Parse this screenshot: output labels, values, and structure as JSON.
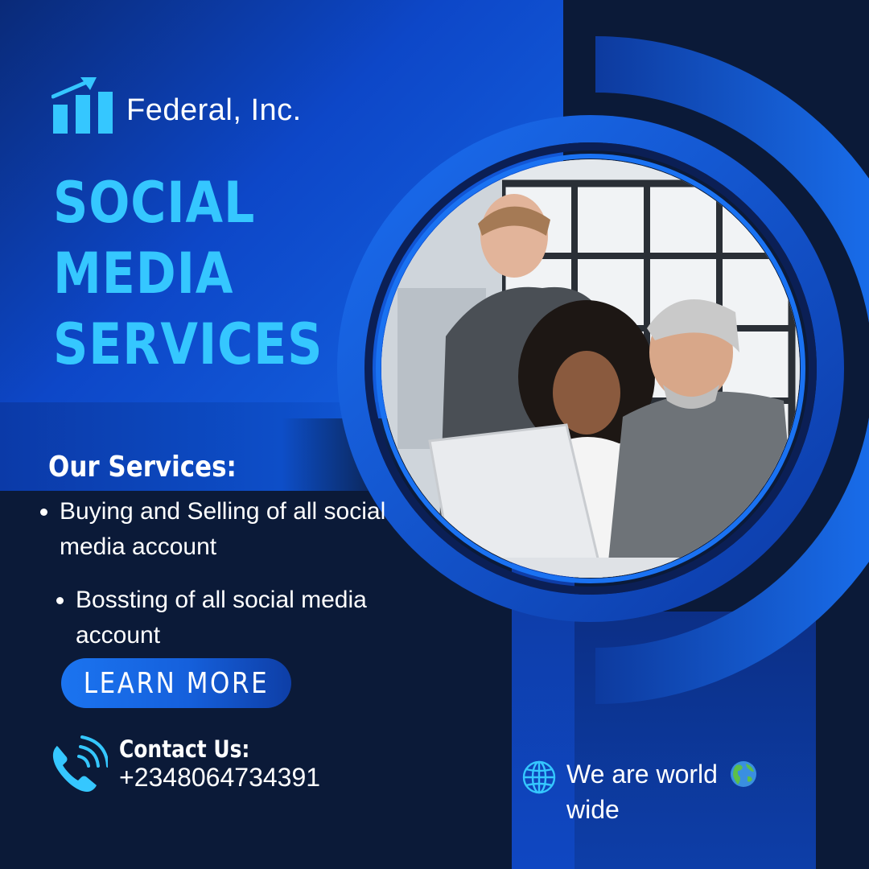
{
  "brand": {
    "name": "Federal, Inc.",
    "logo_icon": "bar-chart-trend-icon"
  },
  "headline": {
    "lines": [
      "SOCIAL",
      "MEDIA",
      "SERVICES"
    ]
  },
  "services": {
    "title": "Our Services:",
    "items": [
      {
        "text": "Buying and Selling of all social media account"
      },
      {
        "text": "Bossting of all social media account"
      }
    ]
  },
  "cta": {
    "label": "LEARN MORE"
  },
  "contact": {
    "label": "Contact Us:",
    "phone": "+2348064734391",
    "icon": "phone-ringing-icon"
  },
  "footer": {
    "world_text": "We are world",
    "world_text_2": "wide",
    "icon": "globe-icon",
    "emoji": "earth-globe-americas-icon"
  },
  "colors": {
    "accent": "#35c7ff",
    "primary_blue": "#1668e6",
    "dark_navy": "#0b1a38",
    "text": "#ffffff"
  },
  "image": {
    "description_icon": "team-meeting-photo"
  }
}
